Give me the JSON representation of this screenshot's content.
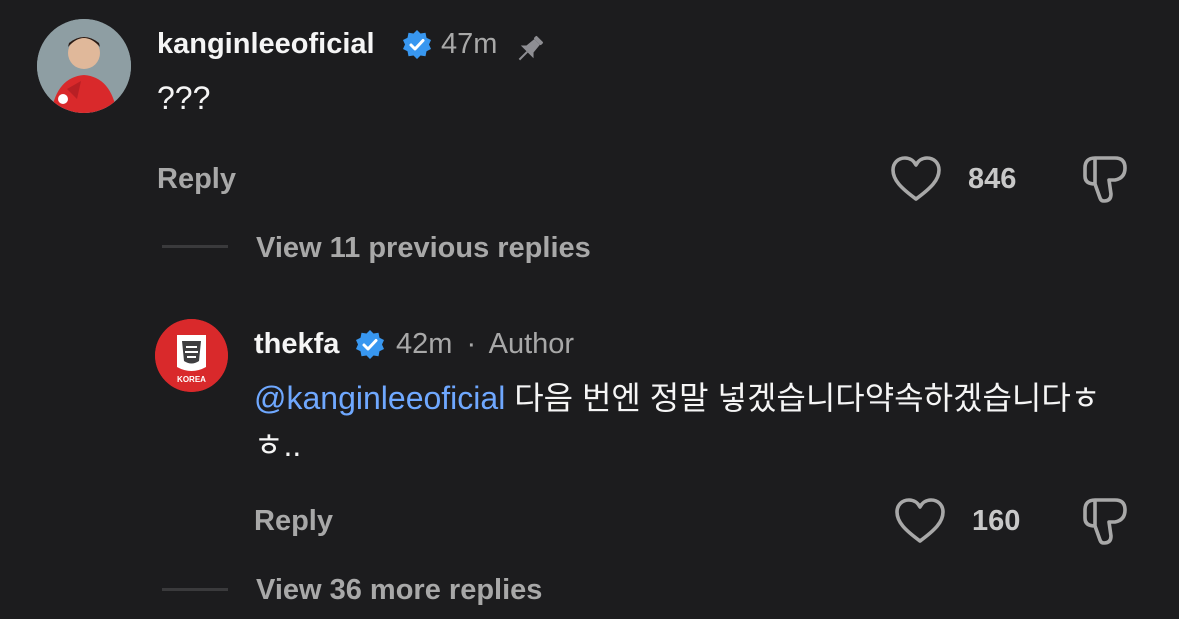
{
  "comment1": {
    "username": "kanginleeoficial",
    "time": "47m",
    "text": "???",
    "reply_label": "Reply",
    "like_count": "846"
  },
  "view_previous": "View 11 previous replies",
  "comment2": {
    "username": "thekfa",
    "time": "42m",
    "separator": "·",
    "author_label": "Author",
    "mention": "@kanginleeoficial",
    "text": " 다음 번엔 정말 넣겠습니다약속하겠습니다ㅎㅎ..",
    "reply_label": "Reply",
    "like_count": "160",
    "avatar_badge": "KOREA"
  },
  "view_more": "View 36 more replies",
  "colors": {
    "background": "#1c1c1e",
    "verified": "#3897f0",
    "mention": "#6fa8ff",
    "kfa_red": "#d9292b"
  }
}
